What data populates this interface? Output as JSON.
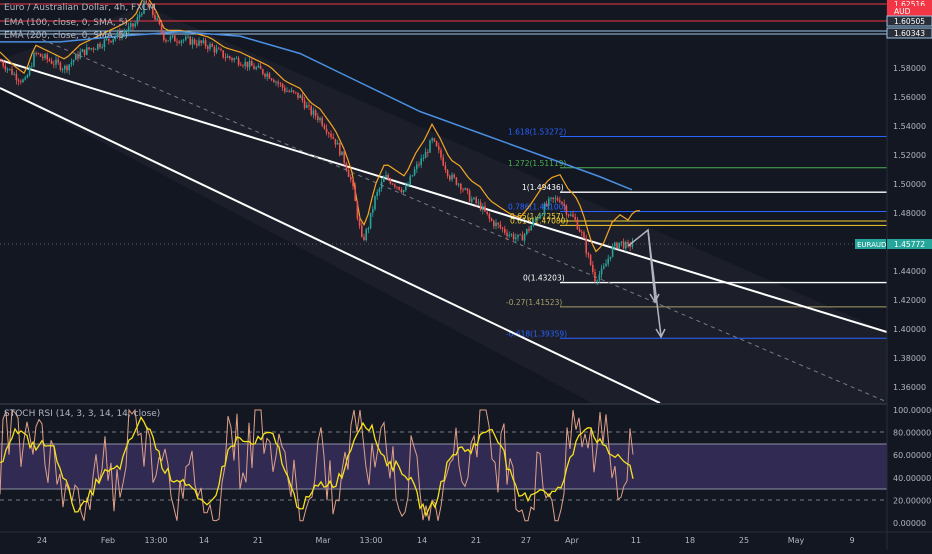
{
  "header": {
    "symbol_line": "Euro / Australian Dollar, 4h, FXCM",
    "ema100_line": "EMA (100, close, 0, SMA, 5)",
    "ema200_line": "EMA (200, close, 0, SMA, 5)",
    "stoch_line": "STOCH RSI (14, 3, 3, 14, 14, close)"
  },
  "colors": {
    "background": "#131722",
    "up_candle": "#26a69a",
    "down_candle": "#ef5350",
    "ema100": "#f5a623",
    "ema200": "#4a90e2",
    "channel": "#ffffff",
    "red_line": "#f23645",
    "fib_gray": "#787b86",
    "fib_blue": "#2962ff",
    "fib_green": "#4caf50",
    "fib_yellow": "#f7d02c",
    "stoch_k": "#f5e21b",
    "stoch_d": "#e0a088",
    "stoch_band": "#3a3160"
  },
  "chart_data": {
    "type": "candlestick",
    "instrument": "EURAUD",
    "timeframe": "4h",
    "x_tick_labels": [
      "24",
      "Feb",
      "13:00",
      "14",
      "21",
      "Mar",
      "13:00",
      "14",
      "21",
      "27",
      "Apr",
      "11",
      "18",
      "25",
      "May",
      "9"
    ],
    "y_tick_labels": [
      "1.36000",
      "1.38000",
      "1.40000",
      "1.42000",
      "1.44000",
      "1.46000",
      "1.48000",
      "1.50000",
      "1.52000",
      "1.54000",
      "1.56000",
      "1.58000"
    ],
    "ylim": [
      1.347,
      1.63
    ],
    "price_badges": [
      {
        "label": "1.62516",
        "color": "#f23645"
      },
      {
        "label": "AUD",
        "color": "#f23645"
      },
      {
        "label": "1.60505",
        "color": "#d1d4dc"
      },
      {
        "label": "1.60343",
        "color": "#d1d4dc"
      },
      {
        "label": "1.45772",
        "color": "#26a69a"
      }
    ],
    "current": {
      "symbol": "EURAUD",
      "price": "1.45772"
    },
    "fib_levels": [
      {
        "label": "1.618(1.53272)",
        "price": 1.53272,
        "color": "#2962ff"
      },
      {
        "label": "1.272(1.51119)",
        "price": 1.51119,
        "color": "#4caf50"
      },
      {
        "label": "1(1.49436)",
        "price": 1.49436,
        "color": "#ffffff"
      },
      {
        "label": "0.786(1.48100)",
        "price": 1.481,
        "color": "#2962ff"
      },
      {
        "label": "0.65(1.47257)",
        "price": 1.4745,
        "color": "#f7d02c"
      },
      {
        "label": "0.618(1.47080)",
        "price": 1.4715,
        "color": "#f7d02c"
      },
      {
        "label": "0(1.43203)",
        "price": 1.43203,
        "color": "#ffffff"
      },
      {
        "label": "-0.27(1.41523)",
        "price": 1.41523,
        "color": "#a89f6a"
      },
      {
        "label": "-0.618(1.39359)",
        "price": 1.39359,
        "color": "#2962ff"
      }
    ],
    "stoch_y_labels": [
      "100.00000",
      "80.00000",
      "60.00000",
      "40.00000",
      "20.00000",
      "0.00000"
    ],
    "stoch_ylim": [
      0,
      100
    ]
  }
}
